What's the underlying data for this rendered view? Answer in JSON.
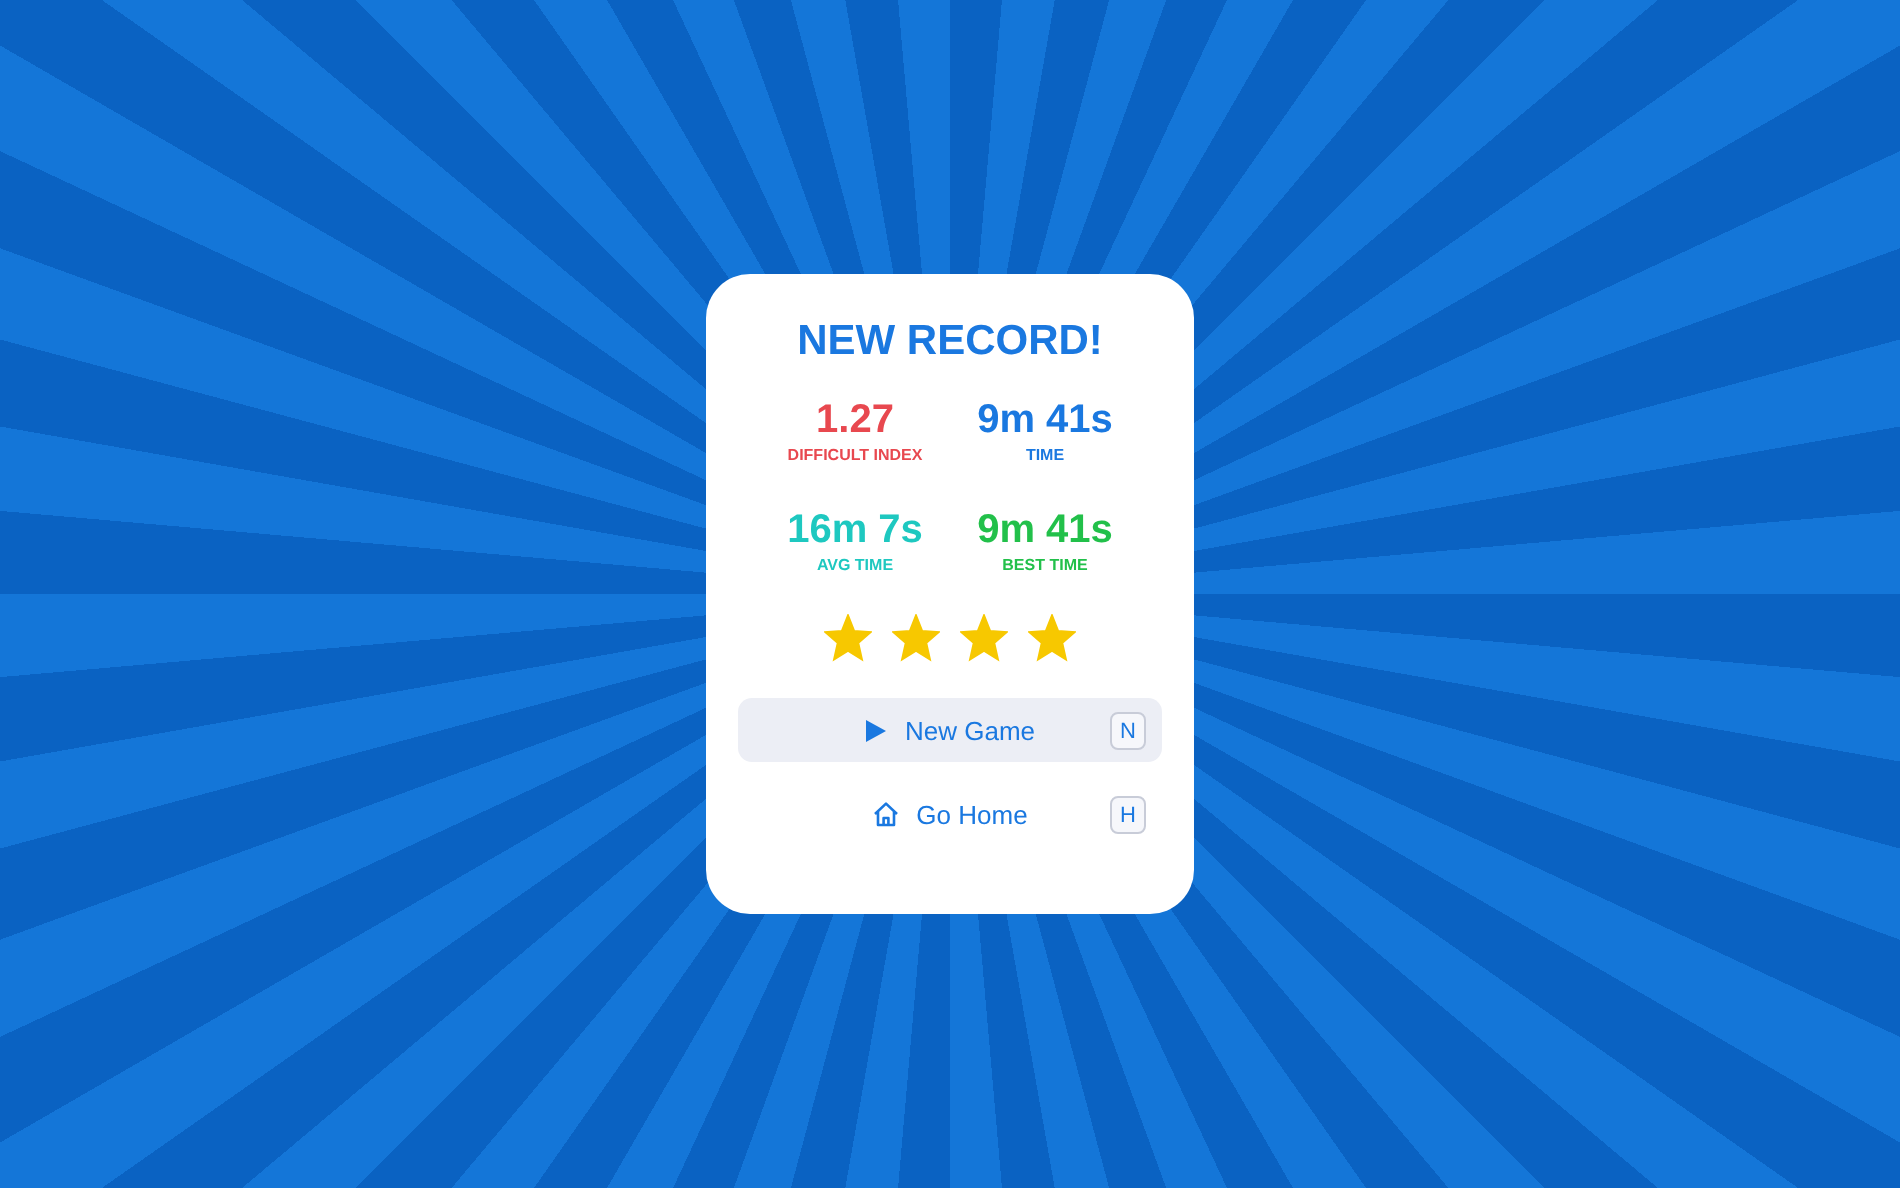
{
  "dialog": {
    "title": "NEW RECORD!",
    "stats": [
      {
        "value": "1.27",
        "label": "DIFFICULT INDEX",
        "color": "#e8484f"
      },
      {
        "value": "9m 41s",
        "label": "TIME",
        "color": "#1a78e0"
      },
      {
        "value": "16m 7s",
        "label": "AVG TIME",
        "color": "#1ec8c0"
      },
      {
        "value": "9m 41s",
        "label": "BEST TIME",
        "color": "#22c04a"
      }
    ],
    "stars": 4,
    "actions": [
      {
        "label": "New Game",
        "kind": "play",
        "shortcut": "N",
        "selected": true
      },
      {
        "label": "Go Home",
        "kind": "home",
        "shortcut": "H",
        "selected": false
      }
    ]
  }
}
